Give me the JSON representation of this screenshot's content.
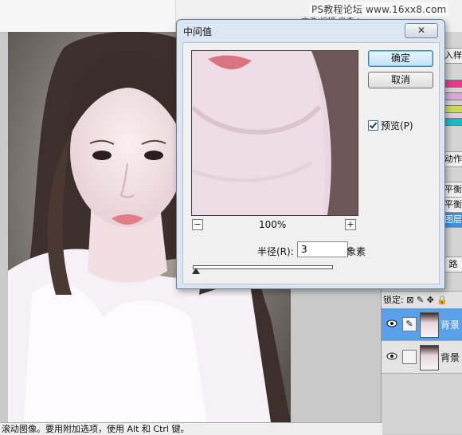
{
  "app": {
    "watermark": "PS教程论坛 www.16xx8.com",
    "top_cut_text": "文件/编辑 自查 (.....",
    "status_bar": "滚动图像。要用附加选项，使用 Alt 和 Ctrl 键。"
  },
  "side_labels": [
    "入样",
    "动作",
    "平衡",
    "平衡",
    "图层",
    "路"
  ],
  "layers_panel": {
    "lock_label": "锁定:",
    "layers": [
      {
        "name": "背景",
        "selected": true
      },
      {
        "name": "背景",
        "selected": false
      }
    ]
  },
  "dialog": {
    "title": "中间值",
    "close_label": "✕",
    "ok_label": "确定",
    "cancel_label": "取消",
    "preview_label": "预览(P)",
    "preview_checked": true,
    "zoom_out_label": "−",
    "zoom_in_label": "+",
    "zoom_level": "100%",
    "radius_label": "半径(R):",
    "radius_value": "3",
    "radius_unit": "象素",
    "radius_slider_level": 0.02
  }
}
